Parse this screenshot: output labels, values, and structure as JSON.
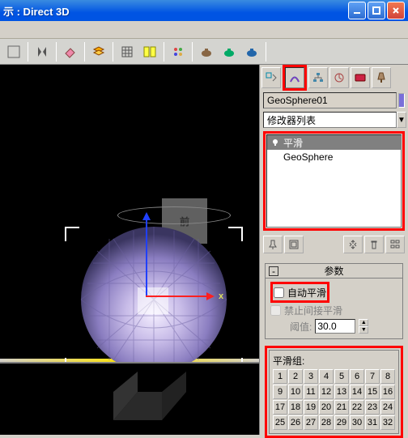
{
  "window": {
    "title": "示 : Direct 3D"
  },
  "cmdpanel": {
    "obj_name": "GeoSphere01",
    "mod_list_label": "修改器列表"
  },
  "stack": {
    "items": [
      {
        "label": "平滑",
        "selected": true,
        "icon": true
      },
      {
        "label": "GeoSphere",
        "selected": false,
        "icon": false
      }
    ]
  },
  "rollout_params": {
    "title": "参数"
  },
  "smoothing": {
    "auto_smooth_label": "自动平滑",
    "prevent_indirect_label": "禁止间接平滑",
    "threshold_label": "阈值:",
    "threshold_value": "30.0",
    "group_label": "平滑组:",
    "buttons": [
      "1",
      "2",
      "3",
      "4",
      "5",
      "6",
      "7",
      "8",
      "9",
      "10",
      "11",
      "12",
      "13",
      "14",
      "15",
      "16",
      "17",
      "18",
      "19",
      "20",
      "21",
      "22",
      "23",
      "24",
      "25",
      "26",
      "27",
      "28",
      "29",
      "30",
      "31",
      "32"
    ]
  },
  "viewport": {
    "front_label": "前",
    "axis_x": "x"
  }
}
